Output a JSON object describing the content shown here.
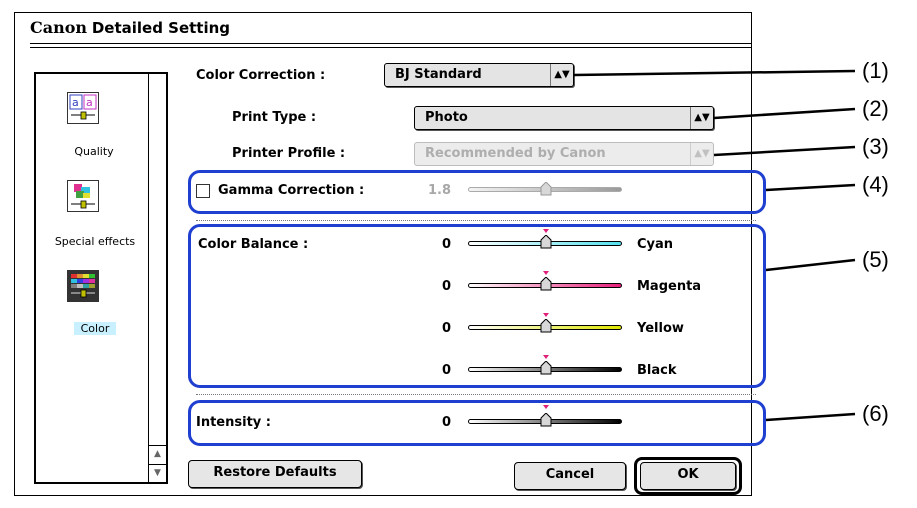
{
  "dialog": {
    "brand": "Canon",
    "title": "Detailed Setting"
  },
  "sidebar": {
    "items": [
      {
        "label": "Quality",
        "icon": "quality-icon",
        "selected": false
      },
      {
        "label": "Special effects",
        "icon": "special-effects-icon",
        "selected": false
      },
      {
        "label": "Color",
        "icon": "color-icon",
        "selected": true
      }
    ]
  },
  "color_correction": {
    "label": "Color Correction :",
    "value": "BJ Standard"
  },
  "print_type": {
    "label": "Print Type :",
    "value": "Photo"
  },
  "printer_profile": {
    "label": "Printer Profile :",
    "value": "Recommended by Canon",
    "enabled": false
  },
  "gamma": {
    "label": "Gamma Correction :",
    "value": "1.8",
    "checked": false,
    "enabled": false
  },
  "color_balance": {
    "label": "Color Balance :",
    "channels": [
      {
        "name": "Cyan",
        "value": "0",
        "color": "#55e0ee"
      },
      {
        "name": "Magenta",
        "value": "0",
        "color": "#e6207a"
      },
      {
        "name": "Yellow",
        "value": "0",
        "color": "#dfe600"
      },
      {
        "name": "Black",
        "value": "0",
        "color": "#000000"
      }
    ]
  },
  "intensity": {
    "label": "Intensity :",
    "value": "0"
  },
  "buttons": {
    "restore": "Restore Defaults",
    "cancel": "Cancel",
    "ok": "OK"
  },
  "callouts": [
    "(1)",
    "(2)",
    "(3)",
    "(4)",
    "(5)",
    "(6)"
  ],
  "colors": {
    "highlight": "#1e3fd0",
    "selection": "#c8f0ff",
    "tick": "#e0207a"
  }
}
